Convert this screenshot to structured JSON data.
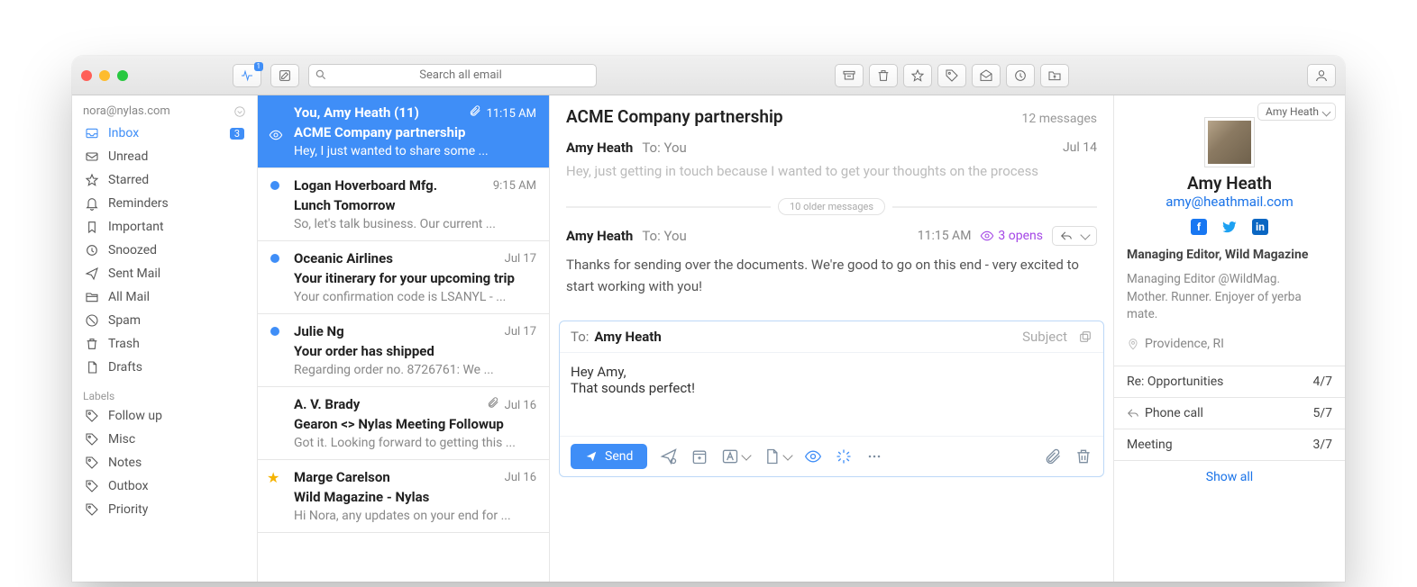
{
  "toolbar": {
    "activity_badge": "1",
    "search_placeholder": "Search all email"
  },
  "sidebar": {
    "account": "nora@nylas.com",
    "folders": [
      {
        "label": "Inbox",
        "icon": "inbox",
        "count": "3",
        "active": true
      },
      {
        "label": "Unread",
        "icon": "mail"
      },
      {
        "label": "Starred",
        "icon": "star"
      },
      {
        "label": "Reminders",
        "icon": "bell"
      },
      {
        "label": "Important",
        "icon": "bookmark"
      },
      {
        "label": "Snoozed",
        "icon": "clock"
      },
      {
        "label": "Sent Mail",
        "icon": "send"
      },
      {
        "label": "All Mail",
        "icon": "stack"
      },
      {
        "label": "Spam",
        "icon": "spam"
      },
      {
        "label": "Trash",
        "icon": "trash"
      },
      {
        "label": "Drafts",
        "icon": "draft"
      }
    ],
    "labels_header": "Labels",
    "labels": [
      {
        "label": "Follow up"
      },
      {
        "label": "Misc"
      },
      {
        "label": "Notes"
      },
      {
        "label": "Outbox"
      },
      {
        "label": "Priority"
      }
    ]
  },
  "threads": [
    {
      "from": "You, Amy Heath (11)",
      "time": "11:15 AM",
      "subject": "ACME Company partnership",
      "preview": "Hey, I just wanted to share some ...",
      "selected": true,
      "attach": true,
      "eye": true
    },
    {
      "from": "Logan Hoverboard Mfg.",
      "time": "9:15 AM",
      "subject": "Lunch Tomorrow",
      "preview": "So, let's talk business. Our current ...",
      "unread": true
    },
    {
      "from": "Oceanic Airlines",
      "time": "Jul 17",
      "subject": "Your itinerary for your upcoming trip",
      "preview": "Your confirmation code is LSANYL - ...",
      "unread": true
    },
    {
      "from": "Julie Ng",
      "time": "Jul 17",
      "subject": "Your order has shipped",
      "preview": "Regarding order no. 8726761: We ...",
      "unread": true
    },
    {
      "from": "A. V. Brady",
      "time": "Jul 16",
      "subject": "Gearon <> Nylas Meeting Followup",
      "preview": "Got it. Looking forward to getting this ...",
      "attach": true
    },
    {
      "from": "Marge Carelson",
      "time": "Jul 16",
      "subject": "Wild Magazine - Nylas",
      "preview": "Hi Nora, any updates on your end for ...",
      "star": true
    }
  ],
  "reader": {
    "subject": "ACME Company partnership",
    "count": "12 messages",
    "older": "10 older messages",
    "msg1": {
      "from": "Amy Heath",
      "to": "To:  You",
      "time": "Jul 14",
      "body": "Hey, just getting in touch because I wanted to get your thoughts on the process"
    },
    "msg2": {
      "from": "Amy Heath",
      "to": "To:  You",
      "time": "11:15 AM",
      "opens": "3 opens",
      "body": "Thanks for sending over the documents. We're good to go on this end - very excited to start working with you!"
    }
  },
  "compose": {
    "to_label": "To:",
    "to_name": "Amy Heath",
    "subject_label": "Subject",
    "body": "Hey Amy,\nThat sounds perfect!",
    "send_label": "Send"
  },
  "profile": {
    "chip": "Amy Heath",
    "name": "Amy Heath",
    "email": "amy@heathmail.com",
    "title": "Managing Editor, Wild Magazine",
    "bio": "Managing Editor @WildMag.\nMother. Runner. Enjoyer of yerba mate.",
    "location": "Providence, RI",
    "related": [
      {
        "label": "Re: Opportunities",
        "meta": "4/7",
        "icon": "none"
      },
      {
        "label": "Phone call",
        "meta": "5/7",
        "icon": "reply"
      },
      {
        "label": "Meeting",
        "meta": "3/7",
        "icon": "none"
      }
    ],
    "show_all": "Show all"
  }
}
